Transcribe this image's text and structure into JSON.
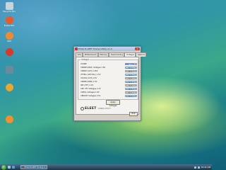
{
  "desktop": {
    "icons": [
      {
        "label": "Recycle Bin",
        "color": "#c8d4dc"
      },
      {
        "label": "EVGA ELV",
        "color": "#e85a2a"
      },
      {
        "label": "GIM",
        "color": "#f08a30"
      },
      {
        "label": "",
        "color": "#d63a2a"
      },
      {
        "label": "",
        "color": "#6a8a9a"
      },
      {
        "label": "",
        "color": "#e8a830"
      },
      {
        "label": "",
        "color": "#f09030"
      }
    ]
  },
  "window": {
    "title": "EVGA E-LEET Tuning Utility v1.0",
    "close": "x",
    "tabs": [
      "CPU",
      "Motherboard",
      "Memory",
      "Overclocking",
      "Voltages",
      "Options"
    ],
    "active_tab_index": 4,
    "group_label": "Voltages",
    "rows": [
      {
        "label": "VCORE",
        "value": "1.4000 V",
        "selected": true
      },
      {
        "label": "VDIMM (MCH) Voltages 1.8V",
        "value": "1.8000 V",
        "selected": false
      },
      {
        "label": "VDMCH (ICH) 1.05V",
        "value": "1.0500 V",
        "selected": false
      },
      {
        "label": "VTTPLL (CPU PLL) 1.5V",
        "value": "1.5000 V",
        "selected": false
      },
      {
        "label": "VCCPLL (ICH) 1.5V",
        "value": "1.5000 V",
        "selected": false
      },
      {
        "label": "VDIMM (DDR) 1.5V",
        "value": "1.5000 V",
        "selected": false
      },
      {
        "label": "QPI (VTT) 1.2V",
        "value": "1.2000 V",
        "selected": false
      },
      {
        "label": "CPU VTT Voltages 1.2V",
        "value": "1.2000 V",
        "selected": false
      },
      {
        "label": "VIOPLL Voltages 1.8V",
        "value": "1.8000 V",
        "selected": false
      },
      {
        "label": "VBOOST Voltages 1.5V",
        "value": "1.5000 V",
        "selected": false
      }
    ],
    "apply_button": "Apply Voltages",
    "logo_text": "ELEET",
    "logo_sub": "TUNING UTILITY",
    "exit_button": "Exit"
  },
  "taskbar": {
    "task_label": "EVGA E-LEET Tuning U...",
    "clock": "10:41 AM"
  }
}
